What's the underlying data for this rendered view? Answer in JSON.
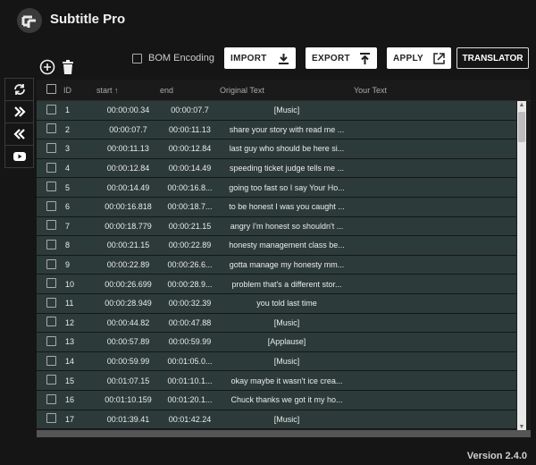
{
  "app": {
    "title": "Subtitle Pro",
    "version": "Version 2.4.0"
  },
  "toolbar": {
    "bom_label": "BOM Encoding",
    "import_label": "IMPORT",
    "export_label": "EXPORT",
    "apply_label": "APPLY",
    "translator_label": "TRANSLATOR"
  },
  "table": {
    "headers": {
      "id": "ID",
      "start": "start ↑",
      "end": "end",
      "original": "Original Text",
      "your": "Your Text"
    },
    "rows": [
      {
        "id": "1",
        "start": "00:00:00.34",
        "end": "00:00:07.7",
        "original": "[Music]"
      },
      {
        "id": "2",
        "start": "00:00:07.7",
        "end": "00:00:11.13",
        "original": "share your story with read me ..."
      },
      {
        "id": "3",
        "start": "00:00:11.13",
        "end": "00:00:12.84",
        "original": "last guy who should be here si..."
      },
      {
        "id": "4",
        "start": "00:00:12.84",
        "end": "00:00:14.49",
        "original": "speeding ticket judge tells me ..."
      },
      {
        "id": "5",
        "start": "00:00:14.49",
        "end": "00:00:16.8...",
        "original": "going too fast so I say Your Ho..."
      },
      {
        "id": "6",
        "start": "00:00:16.818",
        "end": "00:00:18.7...",
        "original": "to be honest I was you caught ..."
      },
      {
        "id": "7",
        "start": "00:00:18.779",
        "end": "00:00:21.15",
        "original": "angry I'm honest so shouldn't ..."
      },
      {
        "id": "8",
        "start": "00:00:21.15",
        "end": "00:00:22.89",
        "original": "honesty management class be..."
      },
      {
        "id": "9",
        "start": "00:00:22.89",
        "end": "00:00:26.6...",
        "original": "gotta manage my honesty mm..."
      },
      {
        "id": "10",
        "start": "00:00:26.699",
        "end": "00:00:28.9...",
        "original": "problem that's a different stor..."
      },
      {
        "id": "11",
        "start": "00:00:28.949",
        "end": "00:00:32.39",
        "original": "you told last time"
      },
      {
        "id": "12",
        "start": "00:00:44.82",
        "end": "00:00:47.88",
        "original": "[Music]"
      },
      {
        "id": "13",
        "start": "00:00:57.89",
        "end": "00:00:59.99",
        "original": "[Applause]"
      },
      {
        "id": "14",
        "start": "00:00:59.99",
        "end": "00:01:05.0...",
        "original": "[Music]"
      },
      {
        "id": "15",
        "start": "00:01:07.15",
        "end": "00:01:10.1...",
        "original": "okay maybe it wasn't ice crea..."
      },
      {
        "id": "16",
        "start": "00:01:10.159",
        "end": "00:01:20.1...",
        "original": "Chuck thanks we got it my ho..."
      },
      {
        "id": "17",
        "start": "00:01:39.41",
        "end": "00:01:42.24",
        "original": "[Music]"
      }
    ]
  },
  "colors": {
    "row_bg": "#2c3b3a",
    "page_bg": "#151515",
    "button_bg": "#ffffff"
  },
  "icons": [
    "logo-icon",
    "add-circle-icon",
    "trash-icon",
    "download-icon",
    "upload-icon",
    "open-external-icon",
    "sync-icon",
    "double-chevron-right-icon",
    "double-chevron-left-icon",
    "youtube-icon"
  ]
}
